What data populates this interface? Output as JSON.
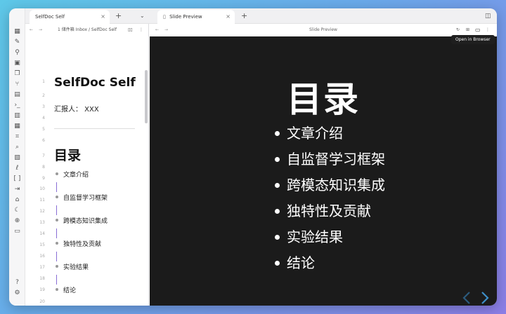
{
  "tabs": {
    "left": {
      "title": "SelfDoc Self",
      "icon": "file-icon"
    },
    "right": {
      "title": "Slide Preview",
      "icon": "file-icon"
    }
  },
  "left_pane": {
    "breadcrumb": "1 储件箱 Inbox / SelfDoc Self"
  },
  "right_pane": {
    "header_title": "Slide Preview",
    "tooltip": "Open in Browser"
  },
  "editor": {
    "line_numbers": [
      "1",
      "2",
      "3",
      "4",
      "5",
      "6",
      "7",
      "8",
      "9",
      "10",
      "11",
      "12",
      "13",
      "14",
      "15",
      "16",
      "17",
      "18",
      "19",
      "20"
    ],
    "title": "SelfDoc Self",
    "reporter": "汇报人： XXX",
    "section_heading": "目录",
    "list_items": [
      "文章介绍",
      "自监督学习框架",
      "跨模态知识集成",
      "独特性及贡献",
      "实验结果",
      "结论"
    ]
  },
  "slide": {
    "title": "目录",
    "items": [
      "文章介绍",
      "自监督学习框架",
      "跨模态知识集成",
      "独特性及贡献",
      "实验结果",
      "结论"
    ]
  },
  "colors": {
    "slide_bg": "#1b1b1b",
    "nav_arrow": "#3d8fc7",
    "sidebar_bg": "#f6f6f7"
  }
}
